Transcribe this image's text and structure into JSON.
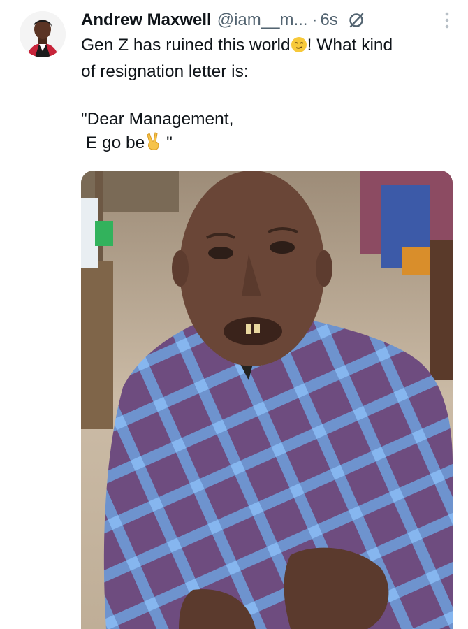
{
  "tweet": {
    "author_name": "Andrew Maxwell",
    "handle": "@iam__m...",
    "separator": "·",
    "time": "6s",
    "line1_before_emoji": "Gen Z has ruined this world",
    "line1_emoji": "relieved-face-emoji",
    "line1_after_emoji": "! What kind",
    "line2": "of resignation letter is:",
    "quote_line1": "\"Dear Management,",
    "quote_line2_text": " E go be",
    "quote_line2_emoji": "victory-hand-emoji",
    "quote_line2_end": " \""
  },
  "icons": {
    "hidden": "hidden-reply-icon",
    "more": "more-options-icon"
  },
  "colors": {
    "text": "#0f1419",
    "secondary": "#536471",
    "shirt_purple": "#6e4c7f",
    "shirt_blue": "#6fa0dc"
  }
}
